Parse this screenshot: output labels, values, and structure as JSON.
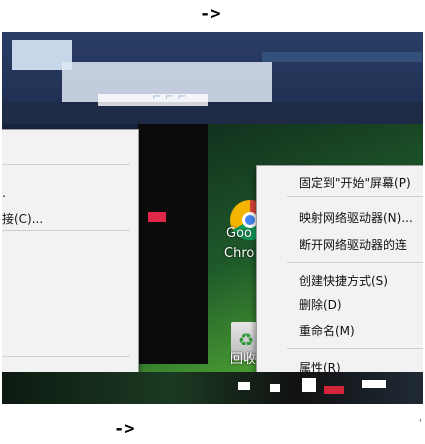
{
  "arrows": {
    "top": "->",
    "bottom": "->"
  },
  "left_menu": {
    "items": [
      {
        "label": "."
      },
      {
        "label": "接(C)..."
      }
    ]
  },
  "desktop": {
    "icons": [
      {
        "name": "Google Chrome",
        "label_line1": "Goo",
        "label_line2": "Chro",
        "icon": "chrome-icon"
      },
      {
        "name": "回收站",
        "label": "回收站",
        "icon": "recycle-bin-icon"
      }
    ]
  },
  "context_menu": {
    "items": [
      {
        "label": "固定到\"开始\"屏幕(P)"
      },
      {
        "label": "映射网络驱动器(N)..."
      },
      {
        "label": "断开网络驱动器的连"
      },
      {
        "label": "创建快捷方式(S)"
      },
      {
        "label": "删除(D)"
      },
      {
        "label": "重命名(M)"
      },
      {
        "label": "属性(R)"
      }
    ]
  },
  "top_window": {
    "glitch_text": "⌐ ⌐ ⌐"
  },
  "corner_mark": "'"
}
